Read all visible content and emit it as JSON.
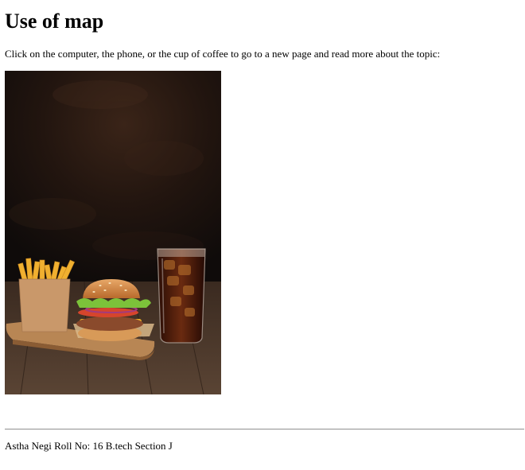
{
  "page": {
    "heading": "Use of map",
    "intro": "Click on the computer, the phone, or the cup of coffee to go to a new page and read more about the topic:"
  },
  "image_map": {
    "image": "burger-fries-cola-photo",
    "hotspots": [
      "fries",
      "burger",
      "cola-glass"
    ]
  },
  "footer": {
    "text": "Astha Negi Roll No: 16 B.tech Section J"
  }
}
